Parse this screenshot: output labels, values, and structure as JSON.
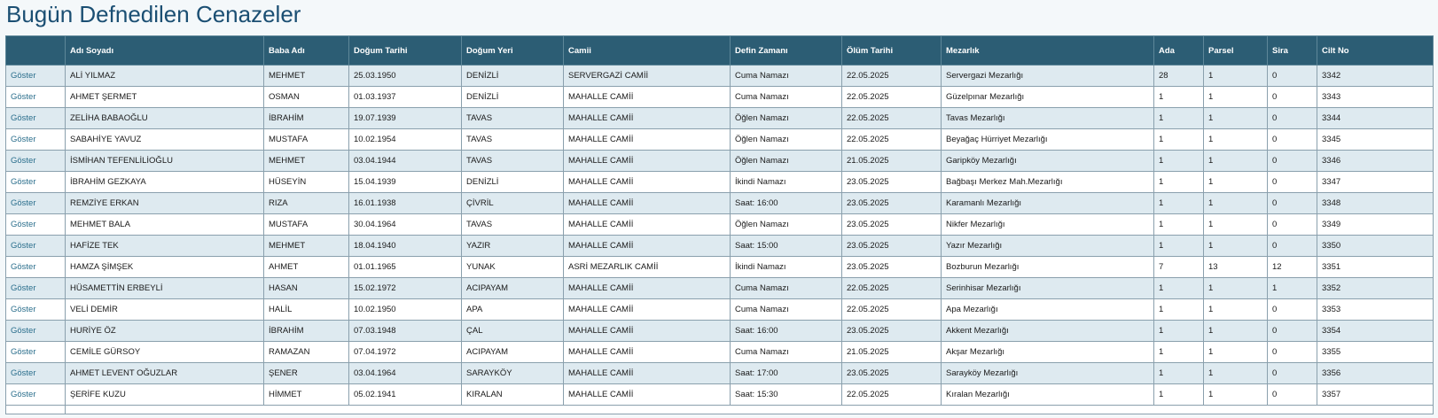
{
  "page": {
    "title": "Bugün Defnedilen Cenazeler"
  },
  "table": {
    "columns": [
      "",
      "Adı Soyadı",
      "Baba Adı",
      "Doğum Tarihi",
      "Doğum Yeri",
      "Camii",
      "Defin Zamanı",
      "Ölüm Tarihi",
      "Mezarlık",
      "Ada",
      "Parsel",
      "Sira",
      "Cilt No"
    ],
    "link_label": "Göster",
    "rows": [
      [
        "ALİ YILMAZ",
        "MEHMET",
        "25.03.1950",
        "DENİZLİ",
        "SERVERGAZİ CAMİİ",
        "Cuma Namazı",
        "22.05.2025",
        "Servergazi Mezarlığı",
        "28",
        "1",
        "0",
        "3342"
      ],
      [
        "AHMET ŞERMET",
        "OSMAN",
        "01.03.1937",
        "DENİZLİ",
        "MAHALLE CAMİİ",
        "Cuma Namazı",
        "22.05.2025",
        "Güzelpınar Mezarlığı",
        "1",
        "1",
        "0",
        "3343"
      ],
      [
        "ZELİHA BABAOĞLU",
        "İBRAHİM",
        "19.07.1939",
        "TAVAS",
        "MAHALLE CAMİİ",
        "Öğlen Namazı",
        "22.05.2025",
        "Tavas Mezarlığı",
        "1",
        "1",
        "0",
        "3344"
      ],
      [
        "SABAHİYE YAVUZ",
        "MUSTAFA",
        "10.02.1954",
        "TAVAS",
        "MAHALLE CAMİİ",
        "Öğlen Namazı",
        "22.05.2025",
        "Beyağaç Hürriyet Mezarlığı",
        "1",
        "1",
        "0",
        "3345"
      ],
      [
        "İSMİHAN TEFENLİLİOĞLU",
        "MEHMET",
        "03.04.1944",
        "TAVAS",
        "MAHALLE CAMİİ",
        "Öğlen Namazı",
        "21.05.2025",
        "Garipköy Mezarlığı",
        "1",
        "1",
        "0",
        "3346"
      ],
      [
        "İBRAHİM GEZKAYA",
        "HÜSEYİN",
        "15.04.1939",
        "DENİZLİ",
        "MAHALLE CAMİİ",
        "İkindi Namazı",
        "23.05.2025",
        "Bağbaşı Merkez Mah.Mezarlığı",
        "1",
        "1",
        "0",
        "3347"
      ],
      [
        "REMZİYE ERKAN",
        "RIZA",
        "16.01.1938",
        "ÇİVRİL",
        "MAHALLE CAMİİ",
        "Saat: 16:00",
        "23.05.2025",
        "Karamanlı Mezarlığı",
        "1",
        "1",
        "0",
        "3348"
      ],
      [
        "MEHMET BALA",
        "MUSTAFA",
        "30.04.1964",
        "TAVAS",
        "MAHALLE CAMİİ",
        "Öğlen Namazı",
        "23.05.2025",
        "Nikfer Mezarlığı",
        "1",
        "1",
        "0",
        "3349"
      ],
      [
        "HAFİZE TEK",
        "MEHMET",
        "18.04.1940",
        "YAZIR",
        "MAHALLE CAMİİ",
        "Saat: 15:00",
        "23.05.2025",
        "Yazır Mezarlığı",
        "1",
        "1",
        "0",
        "3350"
      ],
      [
        "HAMZA ŞİMŞEK",
        "AHMET",
        "01.01.1965",
        "YUNAK",
        "ASRİ MEZARLIK CAMİİ",
        "İkindi Namazı",
        "23.05.2025",
        "Bozburun Mezarlığı",
        "7",
        "13",
        "12",
        "3351"
      ],
      [
        "HÜSAMETTİN ERBEYLİ",
        "HASAN",
        "15.02.1972",
        "ACIPAYAM",
        "MAHALLE CAMİİ",
        "Cuma Namazı",
        "22.05.2025",
        "Serinhisar Mezarlığı",
        "1",
        "1",
        "1",
        "3352"
      ],
      [
        "VELİ DEMİR",
        "HALİL",
        "10.02.1950",
        "APA",
        "MAHALLE CAMİİ",
        "Cuma Namazı",
        "22.05.2025",
        "Apa Mezarlığı",
        "1",
        "1",
        "0",
        "3353"
      ],
      [
        "HURİYE ÖZ",
        "İBRAHİM",
        "07.03.1948",
        "ÇAL",
        "MAHALLE CAMİİ",
        "Saat: 16:00",
        "23.05.2025",
        "Akkent Mezarlığı",
        "1",
        "1",
        "0",
        "3354"
      ],
      [
        "CEMİLE GÜRSOY",
        "RAMAZAN",
        "07.04.1972",
        "ACIPAYAM",
        "MAHALLE CAMİİ",
        "Cuma Namazı",
        "21.05.2025",
        "Akşar Mezarlığı",
        "1",
        "1",
        "0",
        "3355"
      ],
      [
        "AHMET LEVENT OĞUZLAR",
        "ŞENER",
        "03.04.1964",
        "SARAYKÖY",
        "MAHALLE CAMİİ",
        "Saat: 17:00",
        "23.05.2025",
        "Sarayköy Mezarlığı",
        "1",
        "1",
        "0",
        "3356"
      ],
      [
        "ŞERİFE KUZU",
        "HİMMET",
        "05.02.1941",
        "KIRALAN",
        "MAHALLE CAMİİ",
        "Saat: 15:30",
        "22.05.2025",
        "Kıralan Mezarlığı",
        "1",
        "1",
        "0",
        "3357"
      ]
    ]
  }
}
